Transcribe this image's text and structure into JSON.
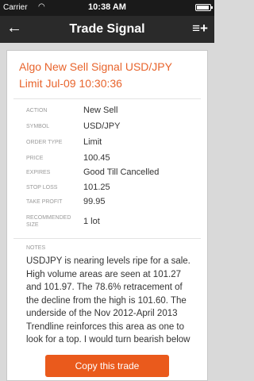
{
  "status": {
    "carrier": "Carrier",
    "time": "10:38 AM"
  },
  "nav": {
    "title": "Trade Signal",
    "back_icon": "←",
    "menu_icon": "≡+"
  },
  "signal": {
    "headline": "Algo New Sell Signal USD/JPY Limit Jul-09 10:30:36",
    "rows": [
      {
        "label": "ACTION",
        "value": "New Sell"
      },
      {
        "label": "SYMBOL",
        "value": "USD/JPY"
      },
      {
        "label": "ORDER TYPE",
        "value": "Limit"
      },
      {
        "label": "PRICE",
        "value": "100.45"
      },
      {
        "label": "EXPIRES",
        "value": "Good Till Cancelled"
      },
      {
        "label": "STOP LOSS",
        "value": "101.25"
      },
      {
        "label": "TAKE PROFIT",
        "value": "99.95"
      },
      {
        "label": "RECOMMENDED SIZE",
        "value": "1 lot"
      }
    ],
    "notes_label": "NOTES",
    "notes": "USDJPY is nearing levels ripe for a sale. High volume areas are seen at 101.27 and 101.97. The 78.6% retracement of the decline from the high is 101.60. The underside of the Nov 2012-April 2013 Trendline reinforces this area as one to look for a top. I would turn bearish below"
  },
  "actions": {
    "copy_label": "Copy this trade"
  },
  "colors": {
    "accent": "#e8642c",
    "button": "#ea5a1c",
    "nav": "#2a2a2a"
  }
}
